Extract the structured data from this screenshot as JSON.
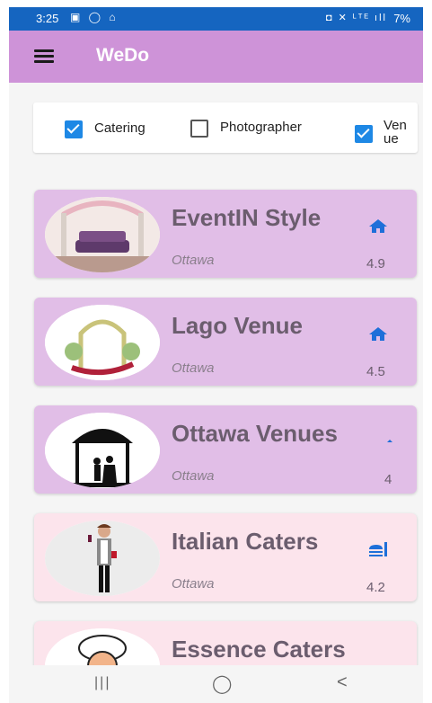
{
  "status_bar": {
    "time": "3:25",
    "left_icons": "▣ ◯ ⌂",
    "right_icons": "◘ ✕ ᴸᵀᴱ ıll",
    "battery": "7%"
  },
  "app_bar": {
    "title": "WeDo",
    "menu_icon": "hamburger-menu-icon",
    "color": "#ce93d8"
  },
  "filters": [
    {
      "label": "Catering",
      "checked": true
    },
    {
      "label": "Photographer",
      "checked": false
    },
    {
      "label_line1": "Ven",
      "label_line2": "ue",
      "checked": true
    }
  ],
  "listings": [
    {
      "name": "EventIN Style",
      "city": "Ottawa",
      "rating": "4.9",
      "type_icon": "home-icon"
    },
    {
      "name": "Lago Venue",
      "city": "Ottawa",
      "rating": "4.5",
      "type_icon": "home-icon"
    },
    {
      "name": "Ottawa Venues",
      "city": "Ottawa",
      "rating": "4",
      "type_icon": "home-icon"
    },
    {
      "name": "Italian Caters",
      "city": "Ottawa",
      "rating": "4.2",
      "type_icon": "food-icon"
    },
    {
      "name": "Essence Caters",
      "city": "",
      "rating": "",
      "type_icon": "food-icon"
    }
  ],
  "colors": {
    "venue_card": "#e1bee7",
    "caterer_card": "#fce4ec",
    "accent": "#1e88e5"
  },
  "nav_bar": {
    "recents": "|||",
    "home": "◯",
    "back": "<"
  }
}
